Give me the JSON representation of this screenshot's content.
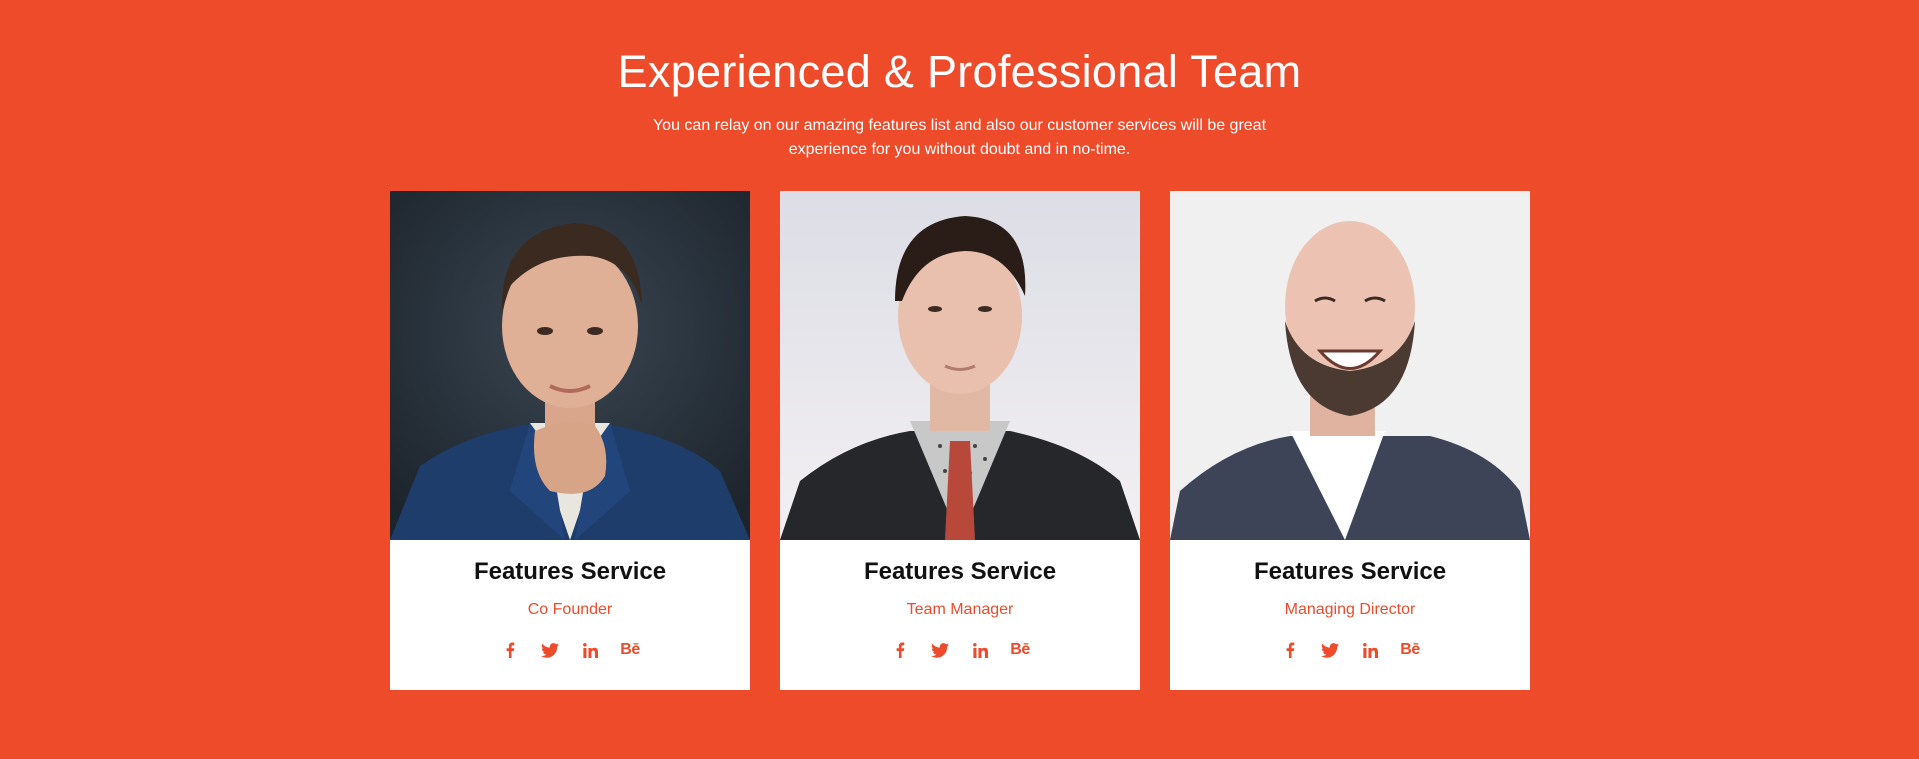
{
  "section": {
    "title": "Experienced & Professional Team",
    "subtitle": "You can relay on our amazing features list and also our customer services will be great experience for you without doubt and in no-time."
  },
  "team": [
    {
      "name": "Features Service",
      "role": "Co Founder",
      "photo": "man-in-blue-suit-portrait"
    },
    {
      "name": "Features Service",
      "role": "Team Manager",
      "photo": "man-in-dark-suit-red-tie-portrait"
    },
    {
      "name": "Features Service",
      "role": "Managing Director",
      "photo": "bald-bearded-man-laughing-portrait"
    }
  ],
  "social_icons": [
    "facebook-icon",
    "twitter-icon",
    "linkedin-icon",
    "behance-icon"
  ],
  "social_labels": {
    "behance": "Bē"
  },
  "colors": {
    "background": "#EE4B2B",
    "accent": "#EE4B2B",
    "card": "#FFFFFF"
  }
}
